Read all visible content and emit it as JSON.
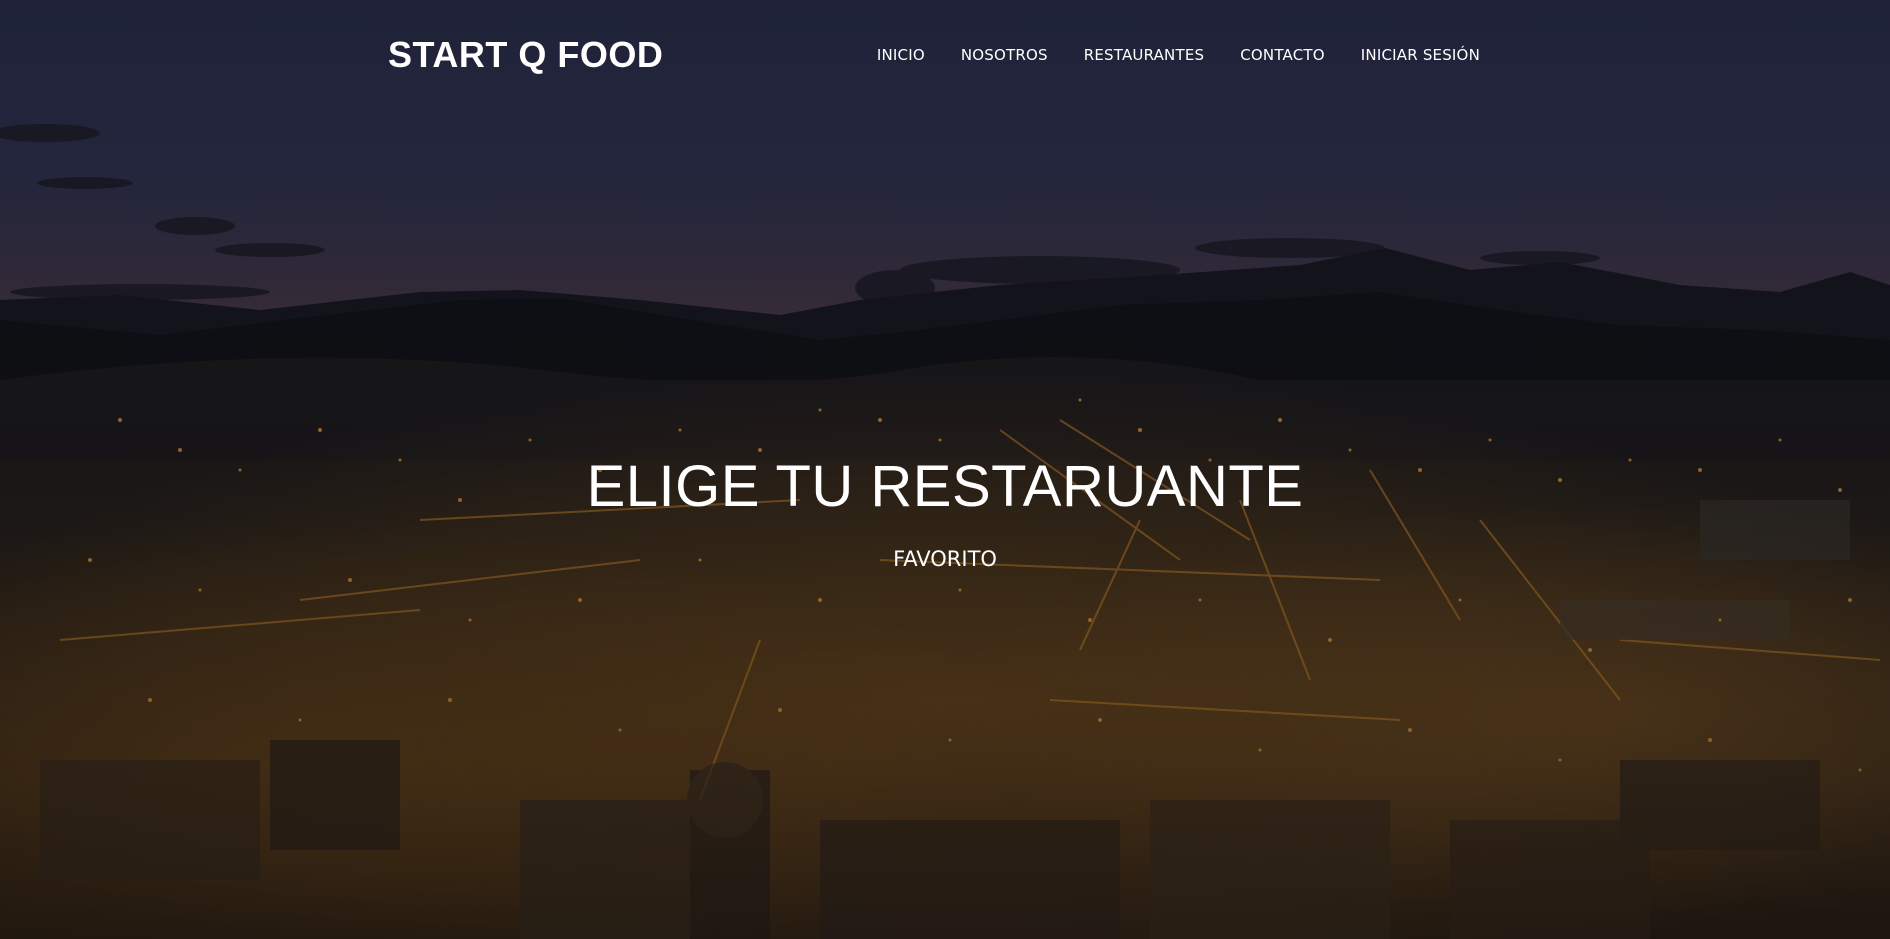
{
  "brand": {
    "name": "START Q FOOD"
  },
  "nav": {
    "items": [
      {
        "label": "INICIO"
      },
      {
        "label": "NOSOTROS"
      },
      {
        "label": "RESTAURANTES"
      },
      {
        "label": "CONTACTO"
      },
      {
        "label": "INICIAR SESIÓN"
      }
    ]
  },
  "hero": {
    "title": "ELIGE TU RESTARUANTE",
    "subtitle": "FAVORITO",
    "background": "night-city-panorama",
    "colors": {
      "sky_top": "#262a45",
      "sky_horizon": "#4a3a4a",
      "mountains": "#15161f",
      "city_lights": "#e0922a",
      "text": "#ffffff"
    }
  }
}
